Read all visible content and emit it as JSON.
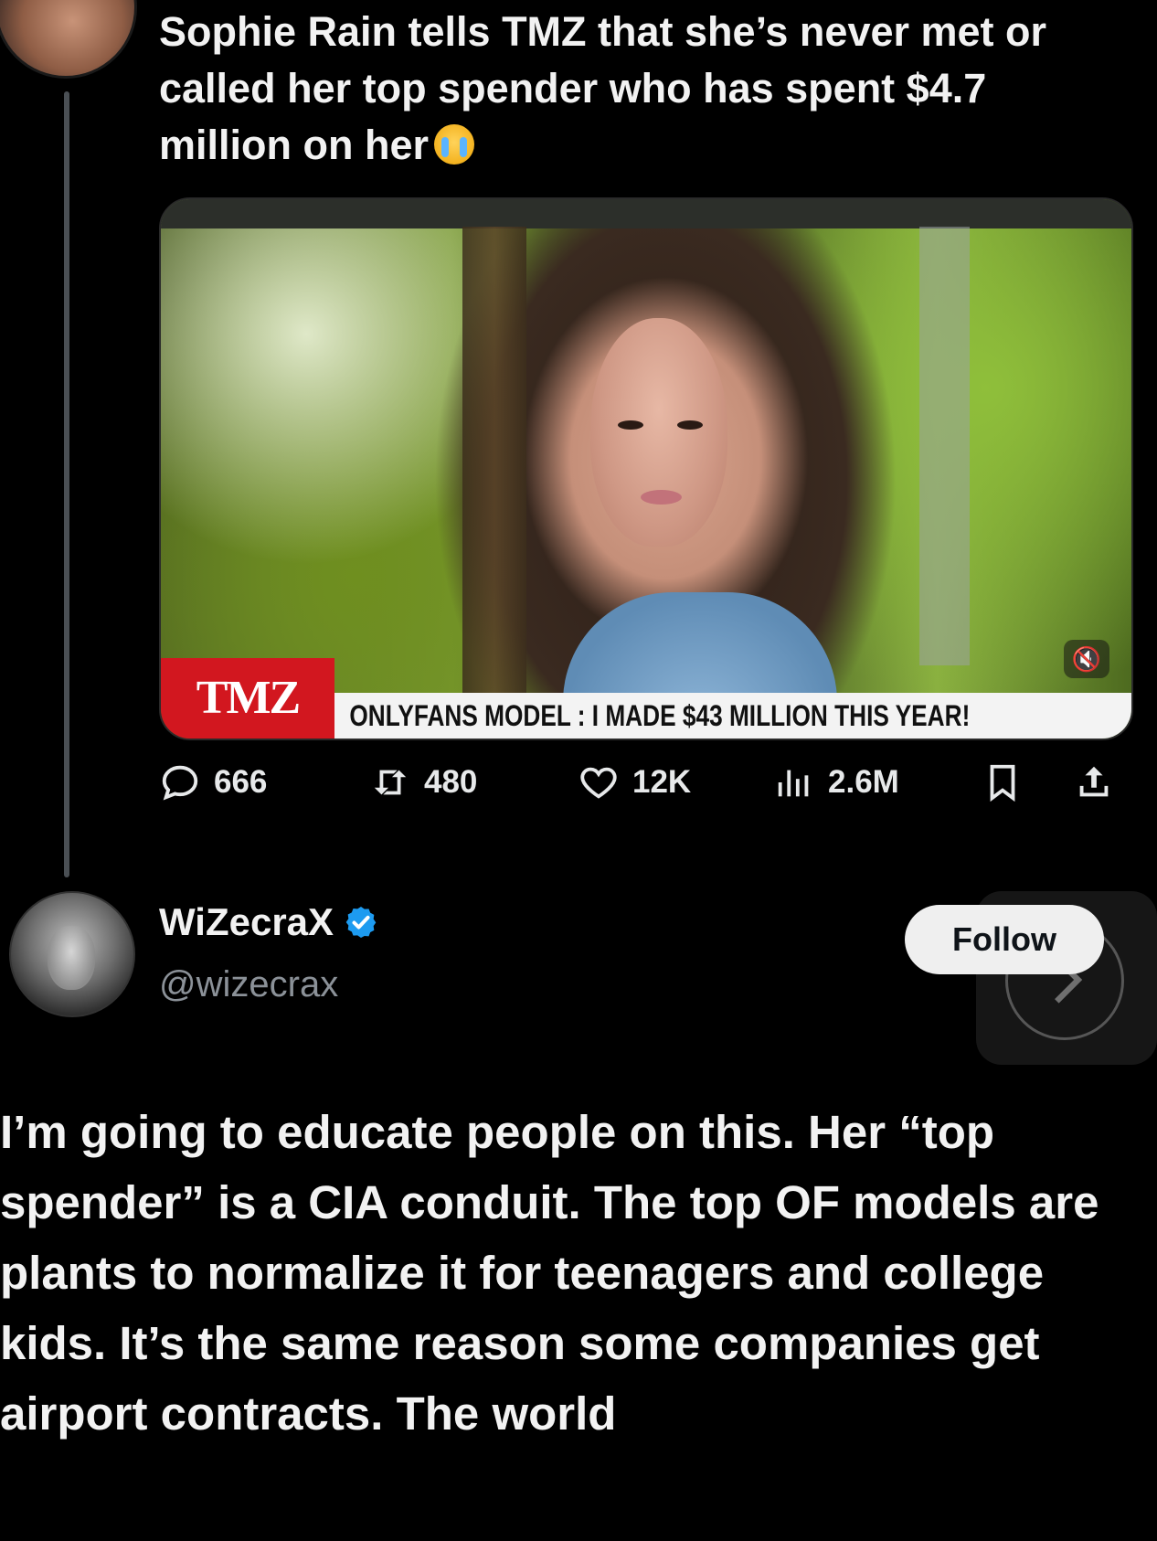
{
  "parent_tweet": {
    "text": "Sophie Rain tells TMZ that she’s never met or called her top spender who has spent $4.7 million on her",
    "emoji": "loudly-crying-face",
    "media": {
      "logo_text": "TMZ",
      "chyron_text": "ONLYFANS MODEL : I MADE $43 MILLION THIS YEAR!",
      "mute_icon": "speaker-muted-icon"
    },
    "stats": {
      "replies": "666",
      "reposts": "480",
      "likes": "12K",
      "views": "2.6M"
    }
  },
  "reply": {
    "display_name": "WiZecraX",
    "handle": "@wizecrax",
    "verified": true,
    "follow_label": "Follow",
    "text": "I’m going to educate people on this. Her “top spender” is a CIA conduit. The top OF models are plants to normalize it for teenagers and college kids. It’s the same reason some companies get airport contracts. The world"
  },
  "colors": {
    "background": "#000000",
    "text": "#f2f2f2",
    "muted": "#8b9198",
    "verified_blue": "#1d9bf0",
    "tmz_red": "#d2171f"
  }
}
